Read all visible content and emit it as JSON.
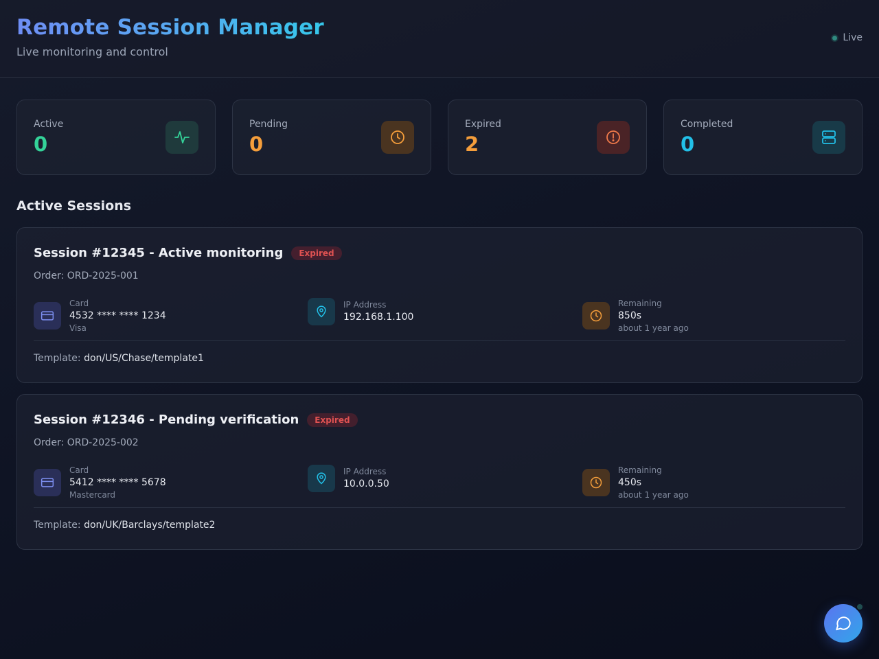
{
  "header": {
    "title": "Remote Session Manager",
    "subtitle": "Live monitoring and control",
    "status": "Live"
  },
  "stats": [
    {
      "label": "Active",
      "value": "0",
      "color": "#34d399",
      "icon": "activity-icon"
    },
    {
      "label": "Pending",
      "value": "0",
      "color": "#f59e3b",
      "icon": "clock-icon"
    },
    {
      "label": "Expired",
      "value": "2",
      "color": "#f59e3b",
      "icon": "alert-circle-icon"
    },
    {
      "label": "Completed",
      "value": "0",
      "color": "#22c0e8",
      "icon": "server-icon"
    }
  ],
  "section_title": "Active Sessions",
  "sessions": [
    {
      "title": "Session #12345 - Active monitoring",
      "status": "Expired",
      "order": "Order: ORD-2025-001",
      "card_label": "Card",
      "card_number": "4532 **** **** 1234",
      "card_brand": "Visa",
      "ip_label": "IP Address",
      "ip": "192.168.1.100",
      "remaining_label": "Remaining",
      "remaining": "850s",
      "remaining_ago": "about 1 year ago",
      "template_label": "Template:",
      "template": "don/US/Chase/template1"
    },
    {
      "title": "Session #12346 - Pending verification",
      "status": "Expired",
      "order": "Order: ORD-2025-002",
      "card_label": "Card",
      "card_number": "5412 **** **** 5678",
      "card_brand": "Mastercard",
      "ip_label": "IP Address",
      "ip": "10.0.0.50",
      "remaining_label": "Remaining",
      "remaining": "450s",
      "remaining_ago": "about 1 year ago",
      "template_label": "Template:",
      "template": "don/UK/Barclays/template2"
    }
  ],
  "chat": {
    "icon": "chat-icon"
  }
}
